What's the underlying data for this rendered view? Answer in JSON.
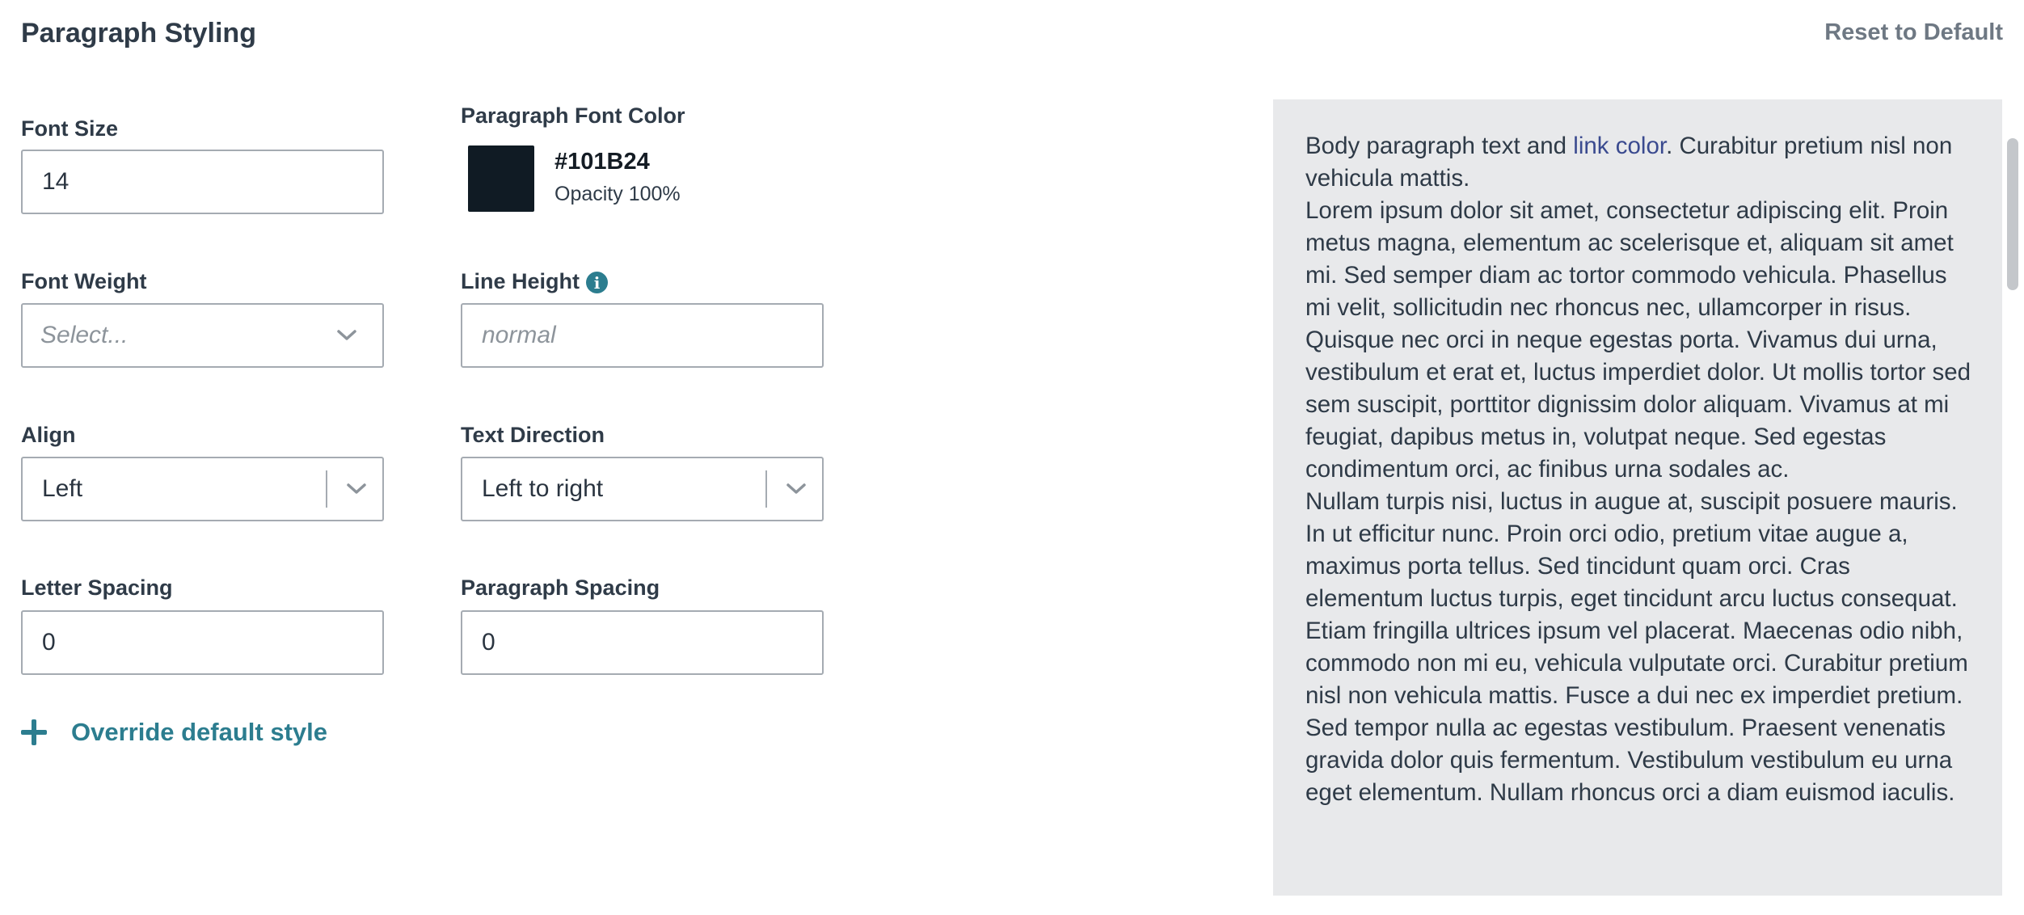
{
  "header": {
    "title": "Paragraph Styling",
    "reset_label": "Reset to Default"
  },
  "fields": {
    "font_size": {
      "label": "Font Size",
      "value": "14"
    },
    "font_color": {
      "label": "Paragraph Font Color",
      "hex": "#101B24",
      "opacity": "Opacity 100%"
    },
    "font_weight": {
      "label": "Font Weight",
      "placeholder": "Select..."
    },
    "line_height": {
      "label": "Line Height",
      "placeholder": "normal",
      "info_icon": "info-icon"
    },
    "align": {
      "label": "Align",
      "value": "Left"
    },
    "text_direction": {
      "label": "Text Direction",
      "value": "Left to right"
    },
    "letter_spacing": {
      "label": "Letter Spacing",
      "value": "0"
    },
    "paragraph_spacing": {
      "label": "Paragraph Spacing",
      "value": "0"
    }
  },
  "override": {
    "label": "Override default style",
    "icon": "plus-icon"
  },
  "preview": {
    "intro_before_link": "Body paragraph text and ",
    "link_text": "link color",
    "intro_after_link": ". Curabitur pretium nisl non vehicula mattis.",
    "paragraph_2": "Lorem ipsum dolor sit amet, consectetur adipiscing elit. Proin metus magna, elementum ac scelerisque et, aliquam sit amet mi. Sed semper diam ac tortor commodo vehicula. Phasellus mi velit, sollicitudin nec rhoncus nec, ullamcorper in risus. Quisque nec orci in neque egestas porta. Vivamus dui urna, vestibulum et erat et, luctus imperdiet dolor. Ut mollis tortor sed sem suscipit, porttitor dignissim dolor aliquam. Vivamus at mi feugiat, dapibus metus in, volutpat neque. Sed egestas condimentum orci, ac finibus urna sodales ac.",
    "paragraph_3": "Nullam turpis nisi, luctus in augue at, suscipit posuere mauris. In ut efficitur nunc. Proin orci odio, pretium vitae augue a, maximus porta tellus. Sed tincidunt quam orci. Cras elementum luctus turpis, eget tincidunt arcu luctus consequat. Etiam fringilla ultrices ipsum vel placerat. Maecenas odio nibh, commodo non mi eu, vehicula vulputate orci. Curabitur pretium nisl non vehicula mattis. Fusce a dui nec ex imperdiet pretium. Sed tempor nulla ac egestas vestibulum. Praesent venenatis gravida dolor quis fermentum. Vestibulum vestibulum eu urna eget elementum. Nullam rhoncus orci a diam euismod iaculis."
  },
  "colors": {
    "accent": "#2c7d8f",
    "text": "#2f3b48",
    "swatch": "#101B24",
    "preview_bg": "#e8e9eb",
    "link": "#3a4a8f"
  }
}
